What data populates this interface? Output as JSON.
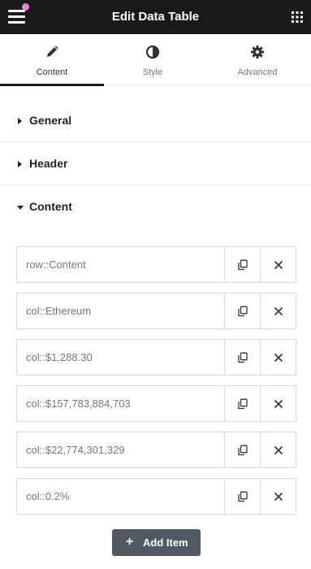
{
  "header": {
    "title": "Edit Data Table"
  },
  "tabs": [
    {
      "label": "Content",
      "icon": "pencil-icon",
      "active": true
    },
    {
      "label": "Style",
      "icon": "half-circle-icon",
      "active": false
    },
    {
      "label": "Advanced",
      "icon": "gear-icon",
      "active": false
    }
  ],
  "sections": [
    {
      "label": "General",
      "expanded": false
    },
    {
      "label": "Header",
      "expanded": false
    },
    {
      "label": "Content",
      "expanded": true
    }
  ],
  "items": [
    {
      "label": "row::Content"
    },
    {
      "label": "col::Ethereum"
    },
    {
      "label": "col::$1,288.30"
    },
    {
      "label": "col::$157,783,884,703"
    },
    {
      "label": "col::$22,774,301,329"
    },
    {
      "label": "col::0.2%"
    }
  ],
  "add_button": {
    "label": "Add Item",
    "icon": "plus-icon"
  },
  "colors": {
    "topbar": "#1a1a1a",
    "accent_dot": "#e87fd8",
    "add_button": "#515962"
  }
}
